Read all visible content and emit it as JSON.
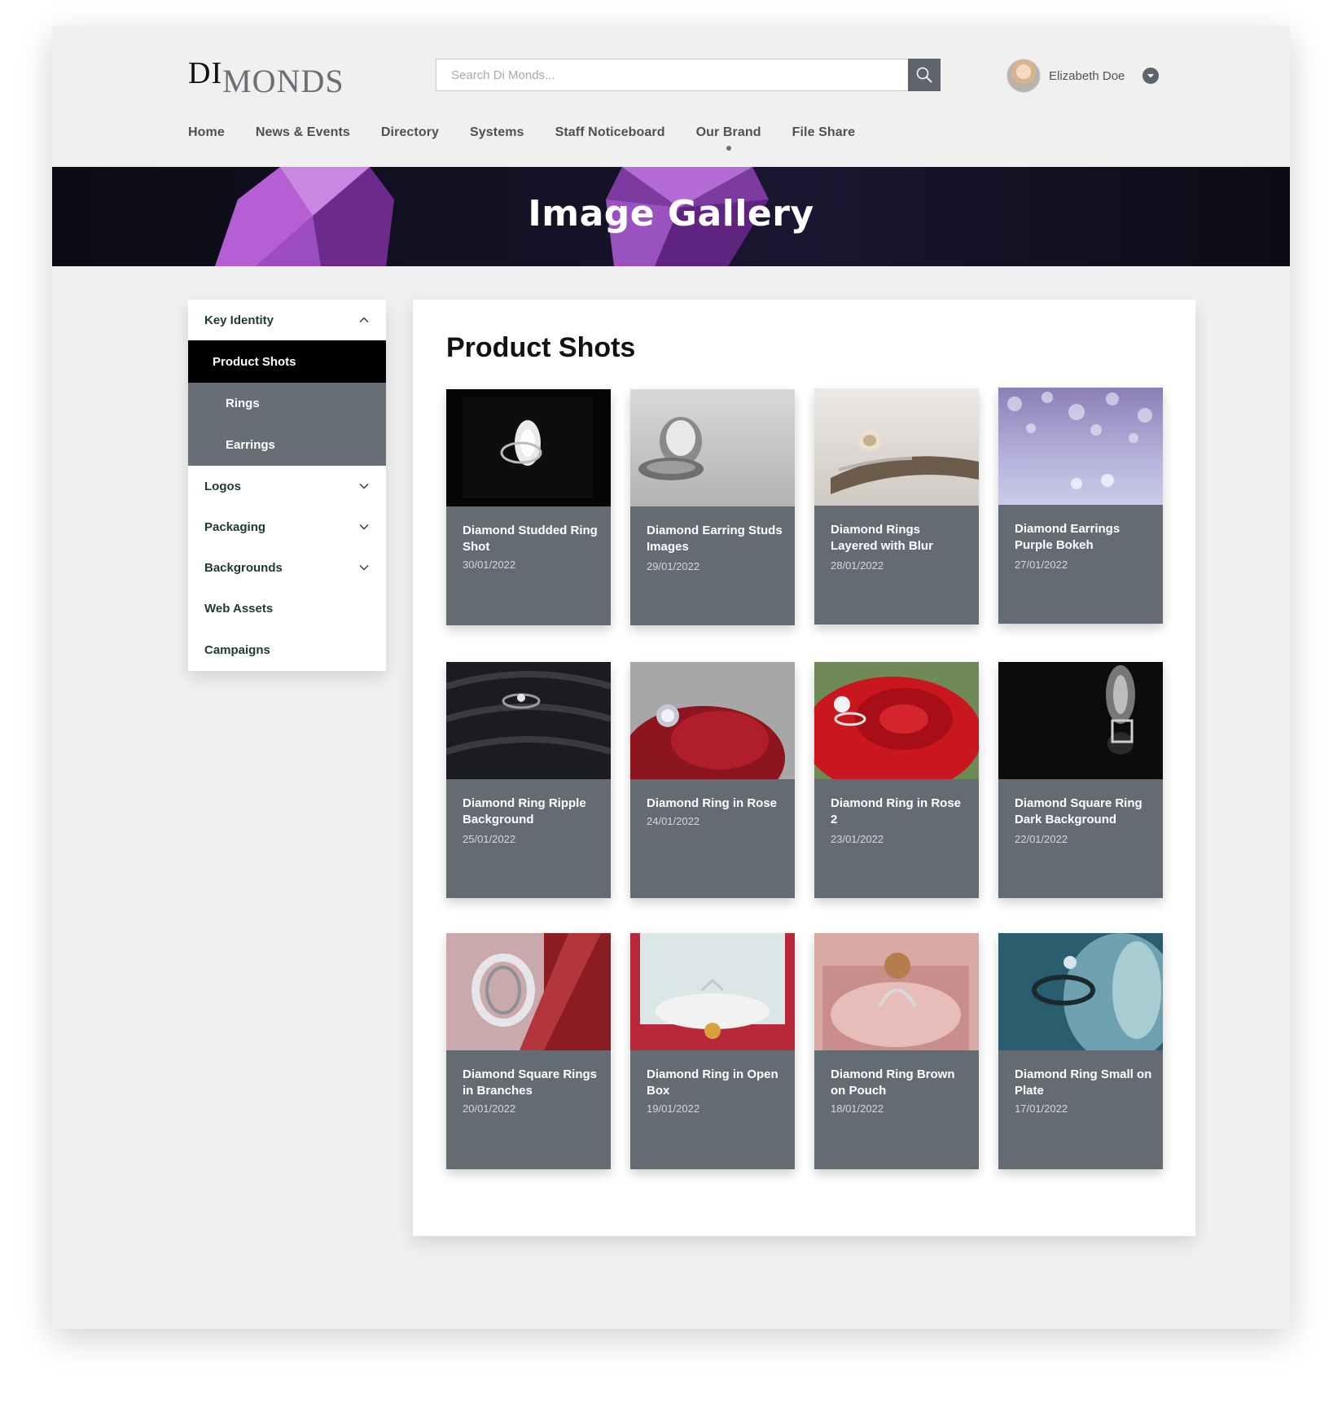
{
  "header": {
    "logo_part1": "DI",
    "logo_part2": "MONDS",
    "search_placeholder": "Search Di Monds...",
    "user_name": "Elizabeth Doe"
  },
  "nav": [
    {
      "label": "Home"
    },
    {
      "label": "News & Events"
    },
    {
      "label": "Directory"
    },
    {
      "label": "Systems"
    },
    {
      "label": "Staff Noticeboard"
    },
    {
      "label": "Our Brand",
      "active": true
    },
    {
      "label": "File Share"
    }
  ],
  "banner": {
    "title": "Image Gallery"
  },
  "sidebar": {
    "items": [
      {
        "label": "Key Identity",
        "chevron": "up"
      },
      {
        "label": "Product Shots",
        "state": "active"
      },
      {
        "label": "Rings",
        "state": "sub"
      },
      {
        "label": "Earrings",
        "state": "sub"
      },
      {
        "label": "Logos",
        "chevron": "down"
      },
      {
        "label": "Packaging",
        "chevron": "down"
      },
      {
        "label": "Backgrounds",
        "chevron": "down"
      },
      {
        "label": "Web Assets"
      },
      {
        "label": "Campaigns"
      }
    ]
  },
  "main": {
    "title": "Product Shots",
    "cards": [
      {
        "title": "Diamond Studded Ring Shot",
        "date": "30/01/2022"
      },
      {
        "title": "Diamond Earring Studs Images",
        "date": "29/01/2022"
      },
      {
        "title": "Diamond Rings Layered with Blur",
        "date": "28/01/2022"
      },
      {
        "title": "Diamond Earrings Purple Bokeh",
        "date": "27/01/2022"
      },
      {
        "title": "Diamond Ring Ripple Background",
        "date": "25/01/2022"
      },
      {
        "title": "Diamond Ring in Rose",
        "date": "24/01/2022"
      },
      {
        "title": "Diamond Ring in Rose 2",
        "date": "23/01/2022"
      },
      {
        "title": "Diamond Square Ring Dark Background",
        "date": "22/01/2022"
      },
      {
        "title": "Diamond Square Rings in Branches",
        "date": "20/01/2022"
      },
      {
        "title": "Diamond Ring in Open Box",
        "date": "19/01/2022"
      },
      {
        "title": "Diamond Ring Brown on Pouch",
        "date": "18/01/2022"
      },
      {
        "title": "Diamond Ring Small on Plate",
        "date": "17/01/2022"
      }
    ]
  },
  "colors": {
    "card_bg": "#646b73",
    "active_nav_bg": "#000000",
    "sub_nav_bg": "#676e75",
    "banner_bg": "#12121f",
    "gem_purple": "#8e3fb0"
  }
}
